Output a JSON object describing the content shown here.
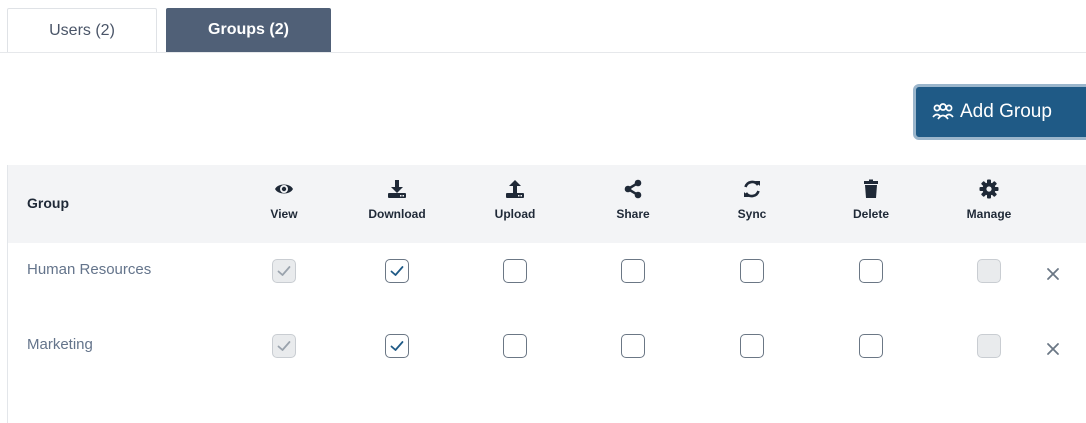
{
  "tabs": [
    {
      "label": "Users (2)",
      "active": false
    },
    {
      "label": "Groups (2)",
      "active": true
    }
  ],
  "add_group_button": {
    "label": "Add Group",
    "icon": "users-icon"
  },
  "table": {
    "group_header": "Group",
    "columns": [
      {
        "label": "View",
        "icon": "eye-icon"
      },
      {
        "label": "Download",
        "icon": "download-icon"
      },
      {
        "label": "Upload",
        "icon": "upload-icon"
      },
      {
        "label": "Share",
        "icon": "share-icon"
      },
      {
        "label": "Sync",
        "icon": "sync-icon"
      },
      {
        "label": "Delete",
        "icon": "trash-icon"
      },
      {
        "label": "Manage",
        "icon": "gear-icon"
      }
    ],
    "rows": [
      {
        "name": "Human Resources",
        "permissions": [
          {
            "checked": true,
            "disabled": true
          },
          {
            "checked": true,
            "disabled": false
          },
          {
            "checked": false,
            "disabled": false
          },
          {
            "checked": false,
            "disabled": false
          },
          {
            "checked": false,
            "disabled": false
          },
          {
            "checked": false,
            "disabled": false
          },
          {
            "checked": false,
            "disabled": true
          }
        ]
      },
      {
        "name": "Marketing",
        "permissions": [
          {
            "checked": true,
            "disabled": true
          },
          {
            "checked": true,
            "disabled": false
          },
          {
            "checked": false,
            "disabled": false
          },
          {
            "checked": false,
            "disabled": false
          },
          {
            "checked": false,
            "disabled": false
          },
          {
            "checked": false,
            "disabled": false
          },
          {
            "checked": false,
            "disabled": true
          }
        ]
      }
    ]
  },
  "colors": {
    "accent": "#1f5a86",
    "tab_active": "#506077",
    "header_bg": "#f3f4f6",
    "check": "#1f5a86"
  }
}
